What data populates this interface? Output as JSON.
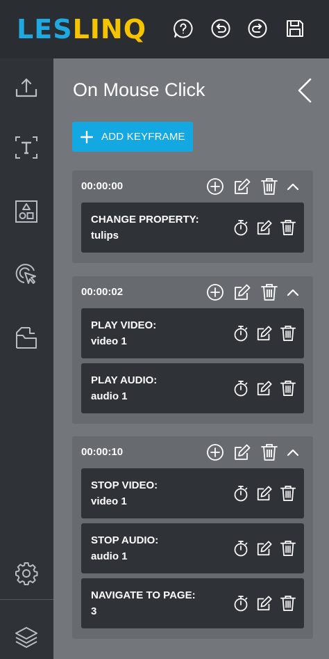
{
  "app": {
    "logo_letters": [
      {
        "char": "L",
        "color": "#1fa9e1"
      },
      {
        "char": "E",
        "color": "#1fa9e1"
      },
      {
        "char": "S",
        "color": "#1fa9e1"
      },
      {
        "char": "L",
        "color": "#f5c400"
      },
      {
        "char": "I",
        "color": "#f5c400"
      },
      {
        "char": "N",
        "color": "#f5c400"
      },
      {
        "char": "Q",
        "color": "#f5c400"
      }
    ],
    "toolbar_icons": [
      "help-icon",
      "undo-icon",
      "redo-icon",
      "save-icon"
    ]
  },
  "sidebar": {
    "icons": [
      "upload-icon",
      "text-icon",
      "shapes-icon",
      "interaction-icon",
      "folder-icon",
      "settings-icon",
      "layers-icon"
    ]
  },
  "panel": {
    "title": "On Mouse Click",
    "add_keyframe_label": "ADD KEYFRAME"
  },
  "keyframes": [
    {
      "time": "00:00:00",
      "actions": [
        {
          "line1": "CHANGE PROPERTY:",
          "line2": "tulips"
        }
      ]
    },
    {
      "time": "00:00:02",
      "actions": [
        {
          "line1": "PLAY VIDEO:",
          "line2": "video 1"
        },
        {
          "line1": "PLAY AUDIO:",
          "line2": "audio 1"
        }
      ]
    },
    {
      "time": "00:00:10",
      "actions": [
        {
          "line1": "STOP VIDEO:",
          "line2": "video 1"
        },
        {
          "line1": "STOP AUDIO:",
          "line2": "audio 1"
        },
        {
          "line1": "NAVIGATE TO PAGE:",
          "line2": "3"
        }
      ]
    }
  ],
  "colors": {
    "accent": "#13a8e2",
    "logo_blue": "#1fa9e1",
    "logo_yellow": "#f5c400"
  }
}
